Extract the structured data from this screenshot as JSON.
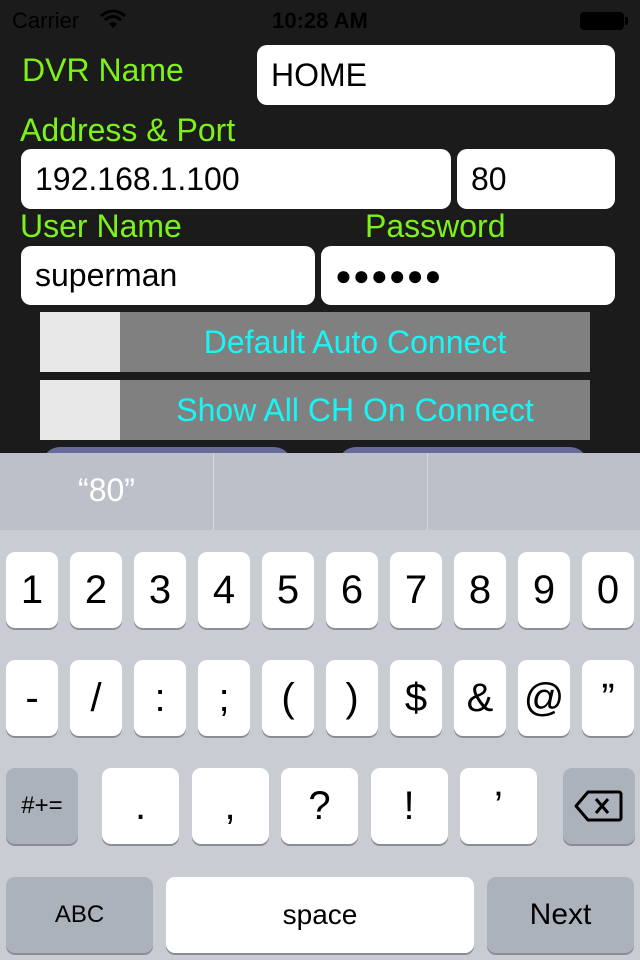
{
  "status_bar": {
    "carrier": "Carrier",
    "time": "10:28 AM",
    "wifi_icon": "wifi-icon",
    "battery_icon": "battery-icon"
  },
  "form": {
    "dvr_name_label": "DVR Name",
    "dvr_name_value": "HOME",
    "address_port_label": "Address & Port",
    "address_value": "192.168.1.100",
    "port_value": "80",
    "username_label": "User Name",
    "username_value": "superman",
    "password_label": "Password",
    "password_value": "●●●●●●",
    "toggle_auto_connect": "Default Auto Connect",
    "toggle_show_all": "Show All CH On Connect"
  },
  "keyboard": {
    "suggestion": "“80”",
    "row1": [
      "1",
      "2",
      "3",
      "4",
      "5",
      "6",
      "7",
      "8",
      "9",
      "0"
    ],
    "row2": [
      "-",
      "/",
      ":",
      ";",
      "(",
      ")",
      "$",
      "&",
      "@",
      "”"
    ],
    "row3": [
      ".",
      ",",
      "?",
      "!",
      "’"
    ],
    "symbols_key": "#+=",
    "abc_key": "ABC",
    "space_key": "space",
    "next_key": "Next",
    "delete_icon": "backspace-icon"
  },
  "colors": {
    "label_green": "#7cf218",
    "toggle_cyan": "#19f5f5",
    "purple_button": "#686a9a"
  }
}
